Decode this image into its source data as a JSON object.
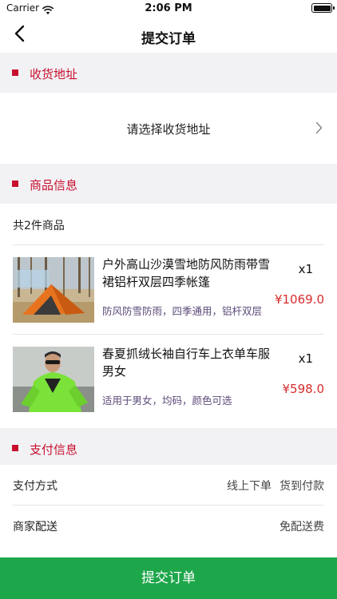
{
  "status_bar": {
    "carrier": "Carrier",
    "time": "2:06 PM"
  },
  "nav": {
    "title": "提交订单"
  },
  "sections": {
    "address": {
      "title": "收货地址",
      "placeholder": "请选择收货地址"
    },
    "goods": {
      "title": "商品信息",
      "count_text": "共2件商品"
    },
    "payment": {
      "title": "支付信息"
    }
  },
  "products": [
    {
      "name": "户外高山沙漠雪地防风防雨带雪裙铝杆双层四季帐篷",
      "spec": "防风防雪防雨，四季通用，铝杆双层",
      "qty": "x1",
      "price": "¥1069.0"
    },
    {
      "name": "春夏抓绒长袖自行车上衣单车服男女",
      "spec": "适用于男女，均码，颜色可选",
      "qty": "x1",
      "price": "¥598.0"
    }
  ],
  "payment": {
    "method_label": "支付方式",
    "method_option_1": "线上下单",
    "method_option_2": "货到付款",
    "delivery_label": "商家配送",
    "delivery_value": "免配送费"
  },
  "submit": {
    "label": "提交订单"
  },
  "colors": {
    "accent": "#c8102e",
    "price": "#d92b2b",
    "submit_bg": "#1ea64a",
    "section_bg": "#f2f2f5"
  }
}
